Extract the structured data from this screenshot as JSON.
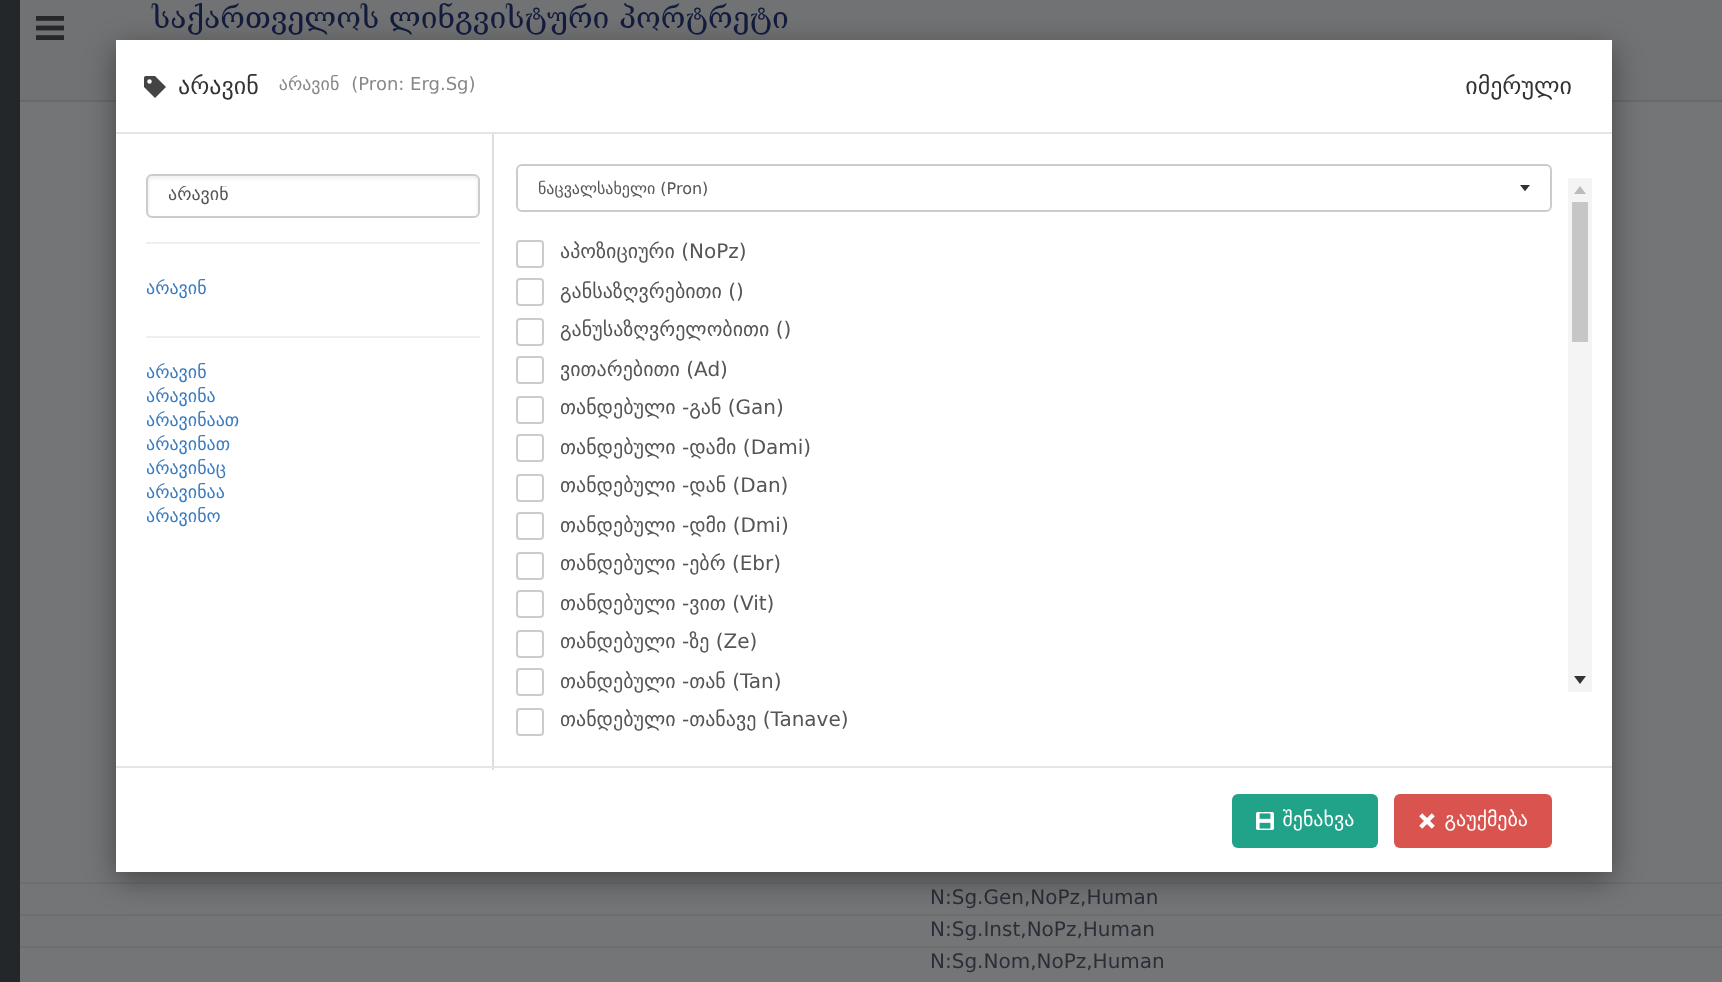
{
  "page": {
    "title": "საქართველოს ლინგვისტური პორტრეტი",
    "rows": [
      {
        "tags": "N:Sg.Gen,NoPz,Human"
      },
      {
        "tags": "N:Sg.Inst,NoPz,Human"
      },
      {
        "tags": "N:Sg.Nom,NoPz,Human"
      }
    ]
  },
  "dialog": {
    "word": "არავინ",
    "lemma": "არავინ",
    "analysis": "(Pron: Erg.Sg)",
    "dialect": "იმერული",
    "search": {
      "value": "არავინ"
    },
    "lemma_link": "არავინ",
    "forms": [
      "არავინ",
      "არავინა",
      "არავინაათ",
      "არავინათ",
      "არავინაც",
      "არავინაა",
      "არავინო"
    ],
    "category": {
      "value": "ნაცვალსახელი (Pron)"
    },
    "features": [
      {
        "label": "აპოზიციური (NoPz)",
        "checked": false
      },
      {
        "label": "განსაზღვრებითი ()",
        "checked": false
      },
      {
        "label": "განუსაზღვრელობითი ()",
        "checked": false
      },
      {
        "label": "ვითარებითი (Ad)",
        "checked": false
      },
      {
        "label": "თანდებული -გან (Gan)",
        "checked": false
      },
      {
        "label": "თანდებული -დამი (Dami)",
        "checked": false
      },
      {
        "label": "თანდებული -დან (Dan)",
        "checked": false
      },
      {
        "label": "თანდებული -დმი (Dmi)",
        "checked": false
      },
      {
        "label": "თანდებული -ებრ (Ebr)",
        "checked": false
      },
      {
        "label": "თანდებული -ვით (Vit)",
        "checked": false
      },
      {
        "label": "თანდებული -ზე (Ze)",
        "checked": false
      },
      {
        "label": "თანდებული -თან (Tan)",
        "checked": false
      },
      {
        "label": "თანდებული -თანავე (Tanave)",
        "checked": false
      }
    ],
    "buttons": [
      {
        "kind": "save",
        "label": "შენახვა"
      },
      {
        "kind": "cancel",
        "label": "გაუქმება"
      }
    ]
  }
}
